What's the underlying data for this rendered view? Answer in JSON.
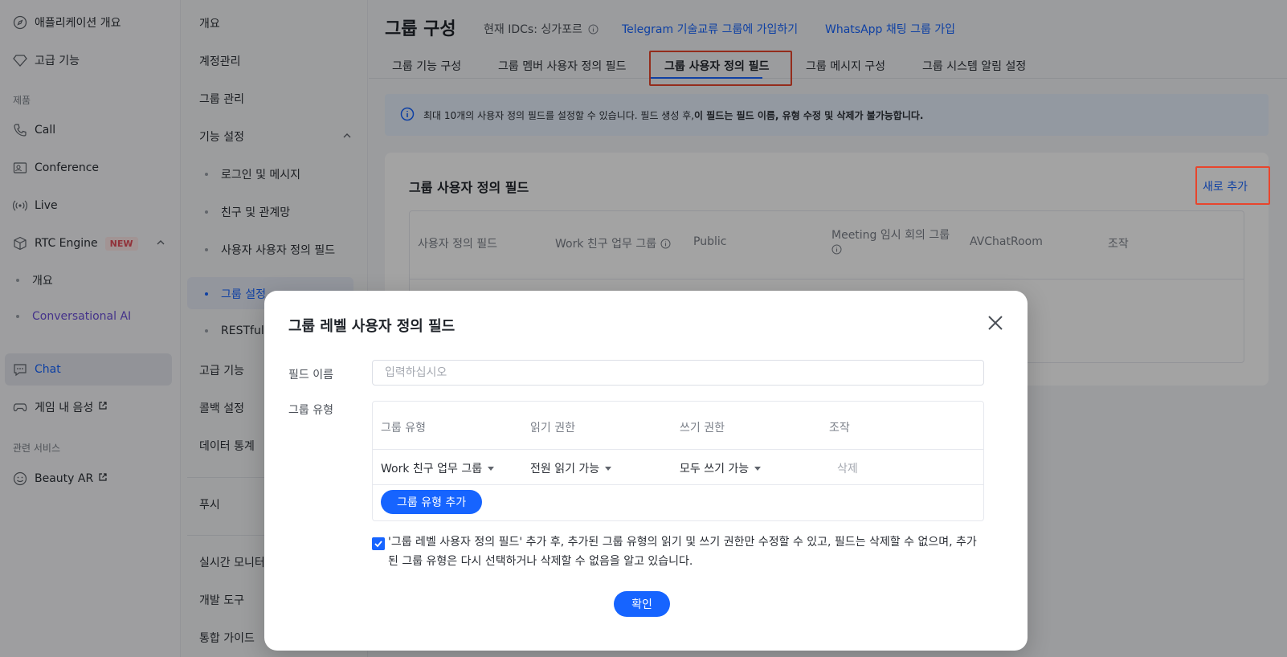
{
  "leftnav": {
    "app_overview": "애플리케이션 개요",
    "advanced": "고급 기능",
    "section_products": "제품",
    "call": "Call",
    "conference": "Conference",
    "live": "Live",
    "rtc_engine": "RTC Engine",
    "new_badge": "NEW",
    "rtc_overview": "개요",
    "conversational_ai": "Conversational AI",
    "chat": "Chat",
    "game_voice": "게임 내 음성",
    "section_related": "관련 서비스",
    "beauty_ar": "Beauty AR"
  },
  "secnav": {
    "overview": "개요",
    "account": "계정관리",
    "group_mgmt": "그룹 관리",
    "feature_settings": "기능 설정",
    "login_message": "로그인 및 메시지",
    "friends": "친구 및 관계망",
    "user_custom_fields": "사용자 사용자 정의 필드",
    "group_settings": "그룹 설정",
    "restful": "RESTful",
    "advanced": "고급 기능",
    "callback": "콜백 설정",
    "data_stats": "데이터 통계",
    "push": "푸시",
    "realtime_monitor": "실시간 모니터",
    "dev_tools": "개발 도구",
    "guide": "통합 가이드"
  },
  "header": {
    "title": "그룹 구성",
    "idc_label": "현재 IDCs: 싱가포르",
    "telegram_link": "Telegram 기술교류 그룹에 가입하기",
    "whatsapp_link": "WhatsApp 채팅 그룹 가입"
  },
  "tabs": [
    {
      "label": "그룹 기능 구성"
    },
    {
      "label": "그룹 멤버 사용자 정의 필드"
    },
    {
      "label": "그룹 사용자 정의 필드"
    },
    {
      "label": "그룹 메시지 구성"
    },
    {
      "label": "그룹 시스템 알림 설정"
    }
  ],
  "notice": {
    "text_plain": "최대 10개의 사용자 정의 필드를 설정할 수 있습니다. 필드 생성 후, ",
    "text_bold": "이 필드는 필드 이름, 유형 수정 및 삭제가 불가능합니다."
  },
  "card": {
    "title": "그룹 사용자 정의 필드",
    "add_new": "새로 추가",
    "columns": [
      "사용자 정의 필드",
      "Work 친구 업무 그룹",
      "Public",
      "Meeting 임시 회의 그룹",
      "AVChatRoom",
      "조작"
    ]
  },
  "modal": {
    "title": "그룹 레벨 사용자 정의 필드",
    "field_name_label": "필드 이름",
    "field_name_placeholder": "입력하십시오",
    "field_name_value": "",
    "group_type_label": "그룹 유형",
    "table_headers": [
      "그룹 유형",
      "읽기 권한",
      "쓰기 권한",
      "조작"
    ],
    "row": {
      "group_type": "Work 친구 업무 그룹",
      "read": "전원 읽기 가능",
      "write": "모두 쓰기 가능",
      "action": "삭제"
    },
    "add_type_button": "그룹 유형 추가",
    "agreement": "'그룹 레벨 사용자 정의 필드' 추가 후, 추가된 그룹 유형의 읽기 및 쓰기 권한만 수정할 수 있고, 필드는 삭제할 수 없으며, 추가된 그룹 유형은 다시 선택하거나 삭제할 수 없음을 알고 있습니다.",
    "agreement_checked": true,
    "confirm_button": "확인"
  },
  "colors": {
    "accent": "#1664ff",
    "highlight": "#e8452c",
    "purple_link": "#6b4fd8"
  }
}
